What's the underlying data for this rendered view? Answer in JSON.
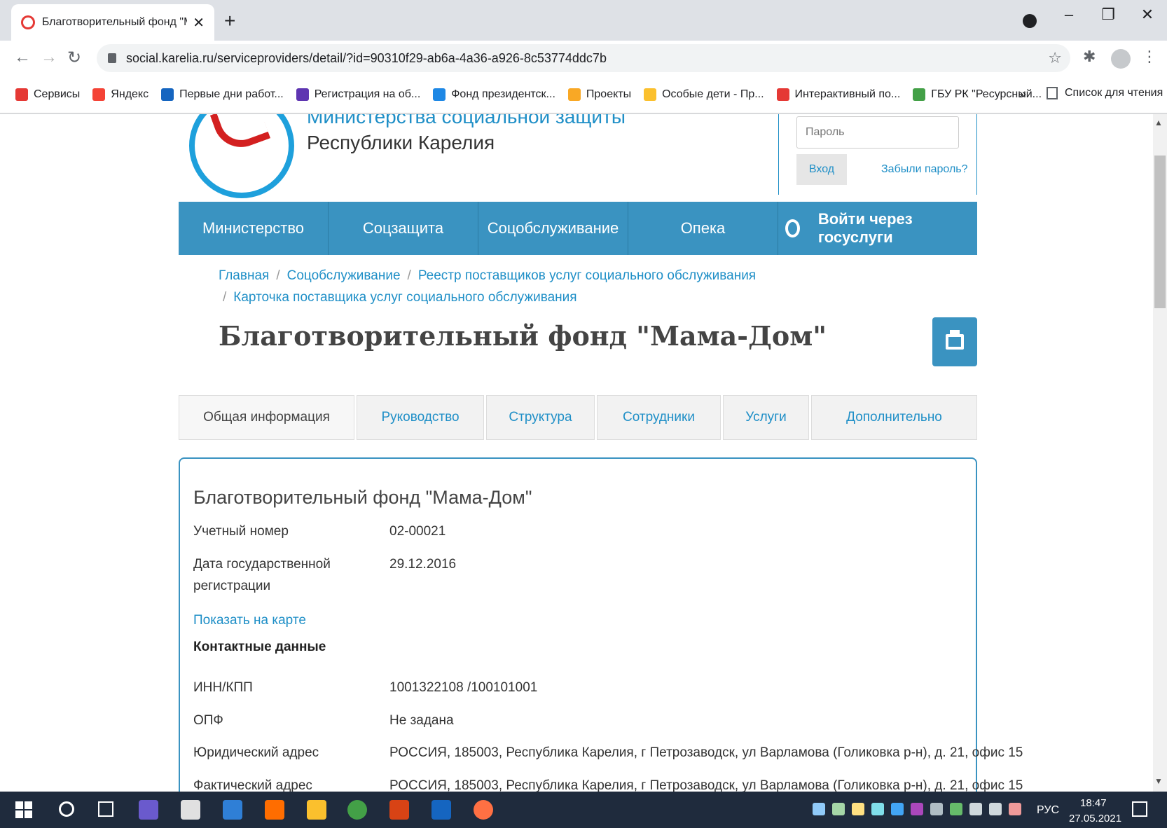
{
  "browser": {
    "tab_title": "Благотворительный фонд \"Мама-Дом\"",
    "url": "social.karelia.ru/serviceproviders/detail/?id=90310f29-ab6a-4a36-a926-8c53774ddc7b",
    "bookmarks": [
      {
        "label": "Сервисы",
        "color": "#e53935"
      },
      {
        "label": "Яндекс",
        "color": "#f44336"
      },
      {
        "label": "Первые дни работ...",
        "color": "#1565c0"
      },
      {
        "label": "Регистрация на об...",
        "color": "#5e35b1"
      },
      {
        "label": "Фонд президентск...",
        "color": "#1e88e5"
      },
      {
        "label": "Проекты",
        "color": "#f9a825"
      },
      {
        "label": "Особые дети - Пр...",
        "color": "#fbc02d"
      },
      {
        "label": "Интерактивный по...",
        "color": "#e53935"
      },
      {
        "label": "ГБУ РК \"Ресурсный...",
        "color": "#43a047"
      }
    ],
    "more_bookmarks": "»",
    "reading_list": "Список для чтения"
  },
  "header": {
    "ministry_line1": "Министерства социальной защиты",
    "ministry_line2": "Республики Карелия",
    "password_placeholder": "Пароль",
    "login_label": "Вход",
    "forgot_label": "Забыли пароль?"
  },
  "nav": {
    "items": [
      "Министерство",
      "Соцзащита",
      "Соцобслуживание",
      "Опека"
    ],
    "gosuslugi": "Войти через госуслуги"
  },
  "breadcrumb": [
    "Главная",
    "Соцобслуживание",
    "Реестр поставщиков услуг социального обслуживания",
    "Карточка поставщика услуг социального обслуживания"
  ],
  "page_title": "Благотворительный фонд \"Мама-Дом\"",
  "tabs": [
    "Общая информация",
    "Руководство",
    "Структура",
    "Сотрудники",
    "Услуги",
    "Дополнительно"
  ],
  "card": {
    "title": "Благотворительный фонд \"Мама-Дом\"",
    "account_label": "Учетный номер",
    "account_value": "02-00021",
    "regdate_label": "Дата государственной регистрации",
    "regdate_value": "29.12.2016",
    "map_link": "Показать на карте",
    "contacts_heading": "Контактные данные",
    "inn_label": "ИНН/КПП",
    "inn_value": "1001322108 /100101001",
    "opf_label": "ОПФ",
    "opf_value": "Не задана",
    "legal_label": "Юридический адрес",
    "legal_value": "РОССИЯ, 185003, Республика Карелия, г Петрозаводск, ул Варламова (Голиковка р-н), д. 21, офис 15",
    "actual_label": "Фактический адрес",
    "actual_value": "РОССИЯ, 185003, Республика Карелия, г Петрозаводск, ул Варламова (Голиковка р-н), д. 21, офис 15"
  },
  "taskbar": {
    "lang": "РУС",
    "time": "18:47",
    "date": "27.05.2021"
  }
}
